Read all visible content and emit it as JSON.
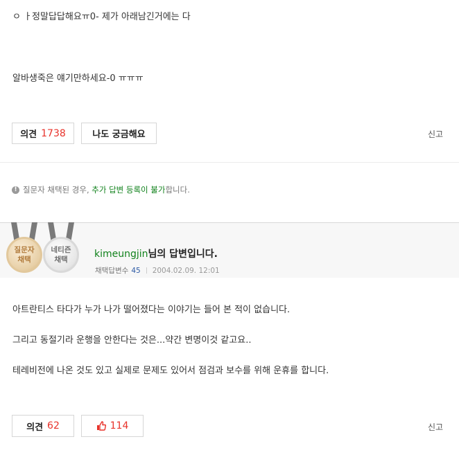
{
  "question": {
    "line1": "ㅇ ㅏ정말답답해요ㅠ0- 제가 아래남긴거에는 다",
    "line2": "알바생죽은 얘기만하세요-0 ㅠㅠㅠ",
    "opinion_label": "의견",
    "opinion_count": "1738",
    "curious_label": "나도 궁금해요",
    "report_label": "신고"
  },
  "notice": {
    "text_before": "질문자 채택된 경우,",
    "highlight": "추가 답변 등록이 불가",
    "text_after": "합니다."
  },
  "answer": {
    "badges": [
      {
        "line1": "질문자",
        "line2": "채택"
      },
      {
        "line1": "네티즌",
        "line2": "채택"
      }
    ],
    "author_id": "kimeungjin",
    "author_suffix": "님의 답변입니다.",
    "adopted_label": "채택답변수",
    "adopted_count": "45",
    "date": "2004.02.09. 12:01",
    "paragraphs": [
      "아트란티스 타다가 누가 나가 떨어졌다는 이야기는 들어 본 적이 없습니다.",
      "그리고 동절기라 운행을 안한다는 것은...약간 변명이것 같고요..",
      "테레비전에 나온 것도 있고 실제로 문제도 있어서 점검과 보수를 위해 운휴를 합니다."
    ],
    "opinion_label": "의견",
    "opinion_count": "62",
    "like_count": "114",
    "report_label": "신고"
  },
  "colors": {
    "accent_red": "#e8322a",
    "accent_green": "#11821c",
    "count_blue": "#2d5aa5"
  },
  "icons": {
    "notice": "info-circle-icon",
    "like": "thumbs-up-icon"
  }
}
